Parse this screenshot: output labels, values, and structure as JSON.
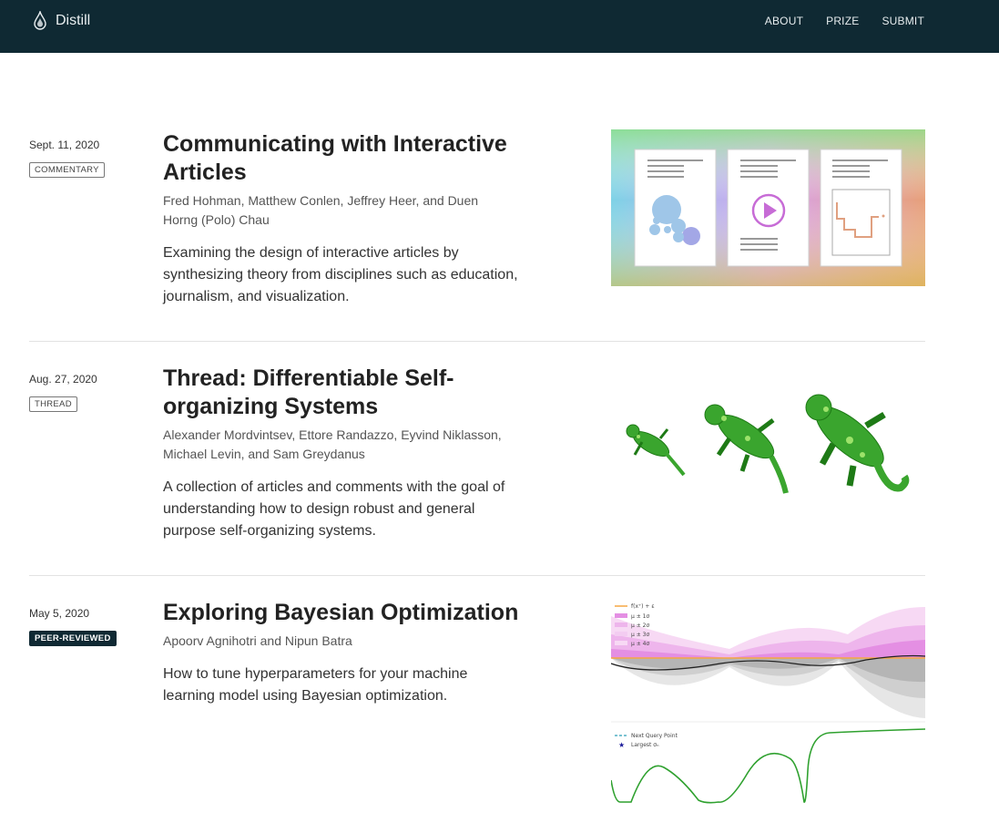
{
  "nav": {
    "brand": "Distill",
    "links": [
      "ABOUT",
      "PRIZE",
      "SUBMIT"
    ]
  },
  "posts": [
    {
      "date": "Sept. 11, 2020",
      "tag": "COMMENTARY",
      "title": "Communicating with Interactive Articles",
      "authors": "Fred Hohman, Matthew Conlen, Jeffrey Heer, and Duen Horng (Polo) Chau",
      "description": "Examining the design of interactive articles by synthesizing theory from disciplines such as education, journalism, and visualization."
    },
    {
      "date": "Aug. 27, 2020",
      "tag": "THREAD",
      "title": "Thread: Differentiable Self-organizing Systems",
      "authors": "Alexander Mordvintsev, Ettore Randazzo, Eyvind Niklasson, Michael Levin, and Sam Greydanus",
      "description": "A collection of articles and comments with the goal of understanding how to design robust and general purpose self-organizing systems."
    },
    {
      "date": "May 5, 2020",
      "tag": "PEER-REVIEWED",
      "title": "Exploring Bayesian Optimization",
      "authors": "Apoorv Agnihotri and Nipun Batra",
      "description": "How to tune hyperparameters for your machine learning model using Bayesian optimization.",
      "figure_legend_top": [
        "f(x⁺) + ε",
        "μ ± 1σ",
        "μ ± 2σ",
        "μ ± 3σ",
        "μ ± 4σ"
      ],
      "figure_legend_bottom": [
        "Next Query Point",
        "Largest σₙ"
      ]
    }
  ],
  "colors": {
    "header_bg": "#0f2933",
    "badge_dark": "#0f2933"
  }
}
